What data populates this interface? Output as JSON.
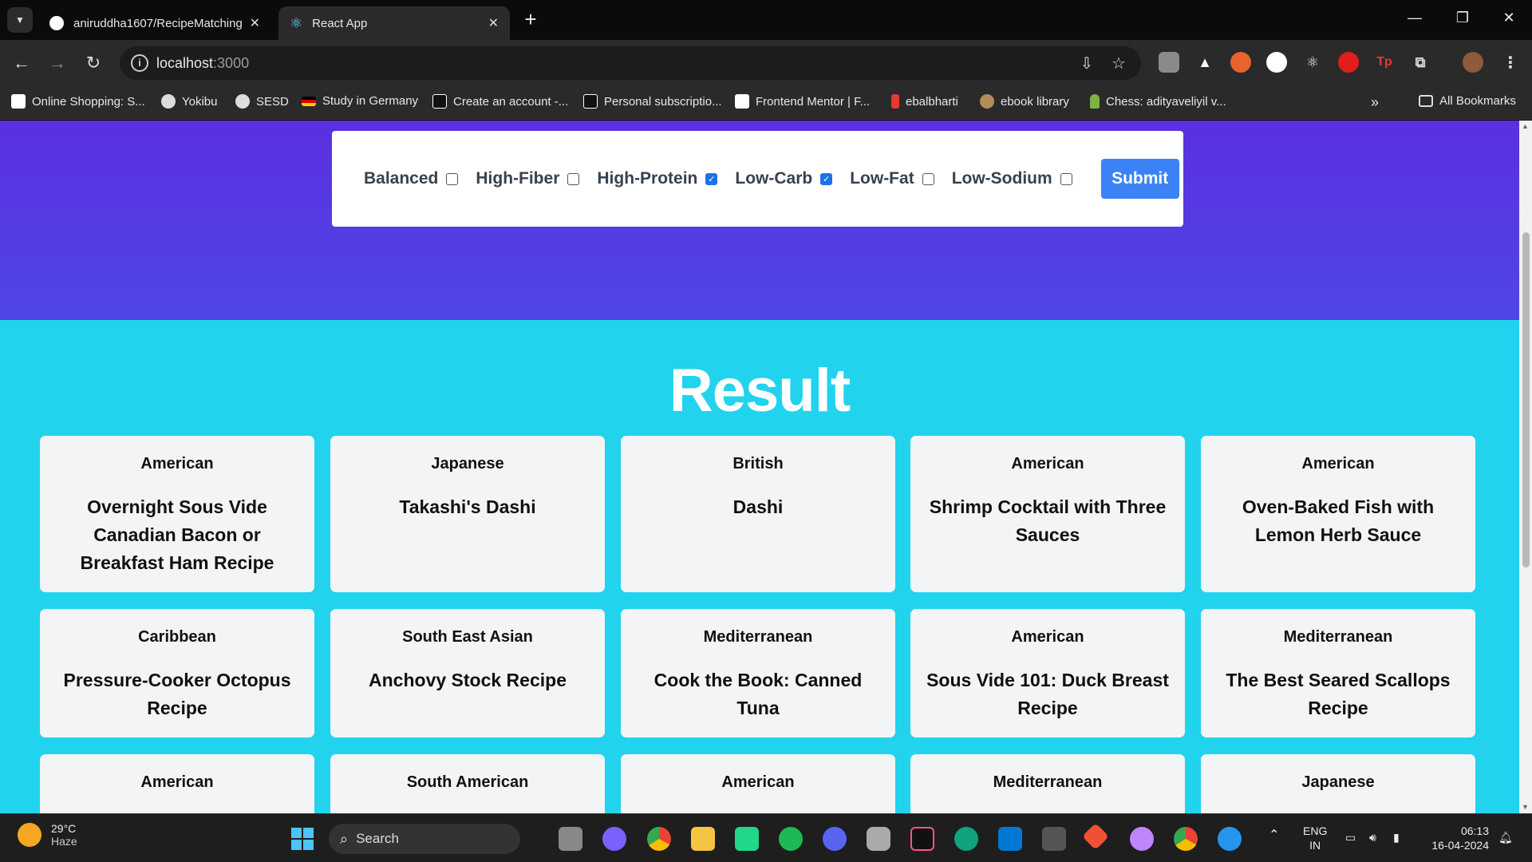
{
  "browser": {
    "tabs": [
      {
        "title": "aniruddha1607/RecipeMatching",
        "icon": "github-icon"
      },
      {
        "title": "React App",
        "icon": "react-icon"
      }
    ],
    "url_host": "localhost",
    "url_port": ":3000",
    "bookmarks": [
      {
        "label": "Online Shopping: S...",
        "color": "#ffffff"
      },
      {
        "label": "Yokibu",
        "color": "#dddddd"
      },
      {
        "label": "SESD",
        "color": "#dddddd"
      },
      {
        "label": "Study in Germany",
        "color": "#d4a017"
      },
      {
        "label": "Create an account -...",
        "color": "#111111"
      },
      {
        "label": "Personal subscriptio...",
        "color": "#111111"
      },
      {
        "label": "Frontend Mentor | F...",
        "color": "#ffffff"
      },
      {
        "label": "ebalbharti",
        "color": "#e53935"
      },
      {
        "label": "ebook library",
        "color": "#b58b5a"
      },
      {
        "label": "Chess: adityaveliyil v...",
        "color": "#7cb342"
      }
    ],
    "all_bookmarks": "All Bookmarks"
  },
  "filters": {
    "options": [
      {
        "label": "Balanced",
        "checked": false
      },
      {
        "label": "High-Fiber",
        "checked": false
      },
      {
        "label": "High-Protein",
        "checked": true
      },
      {
        "label": "Low-Carb",
        "checked": true
      },
      {
        "label": "Low-Fat",
        "checked": false
      },
      {
        "label": "Low-Sodium",
        "checked": false
      }
    ],
    "submit_label": "Submit"
  },
  "result": {
    "title": "Result",
    "cards": [
      {
        "cuisine": "American",
        "name": "Overnight Sous Vide Canadian Bacon or Breakfast Ham Recipe"
      },
      {
        "cuisine": "Japanese",
        "name": "Takashi's Dashi"
      },
      {
        "cuisine": "British",
        "name": "Dashi"
      },
      {
        "cuisine": "American",
        "name": "Shrimp Cocktail with Three Sauces"
      },
      {
        "cuisine": "American",
        "name": "Oven-Baked Fish with Lemon Herb Sauce"
      },
      {
        "cuisine": "Caribbean",
        "name": "Pressure-Cooker Octopus Recipe"
      },
      {
        "cuisine": "South East Asian",
        "name": "Anchovy Stock Recipe"
      },
      {
        "cuisine": "Mediterranean",
        "name": "Cook the Book: Canned Tuna"
      },
      {
        "cuisine": "American",
        "name": "Sous Vide 101: Duck Breast Recipe"
      },
      {
        "cuisine": "Mediterranean",
        "name": "The Best Seared Scallops Recipe"
      },
      {
        "cuisine": "American",
        "name": ""
      },
      {
        "cuisine": "South American",
        "name": ""
      },
      {
        "cuisine": "American",
        "name": ""
      },
      {
        "cuisine": "Mediterranean",
        "name": ""
      },
      {
        "cuisine": "Japanese",
        "name": ""
      }
    ]
  },
  "taskbar": {
    "temperature": "29°C",
    "weather": "Haze",
    "search_label": "Search",
    "lang": "ENG",
    "region": "IN",
    "time": "06:13",
    "date": "16-04-2024"
  }
}
